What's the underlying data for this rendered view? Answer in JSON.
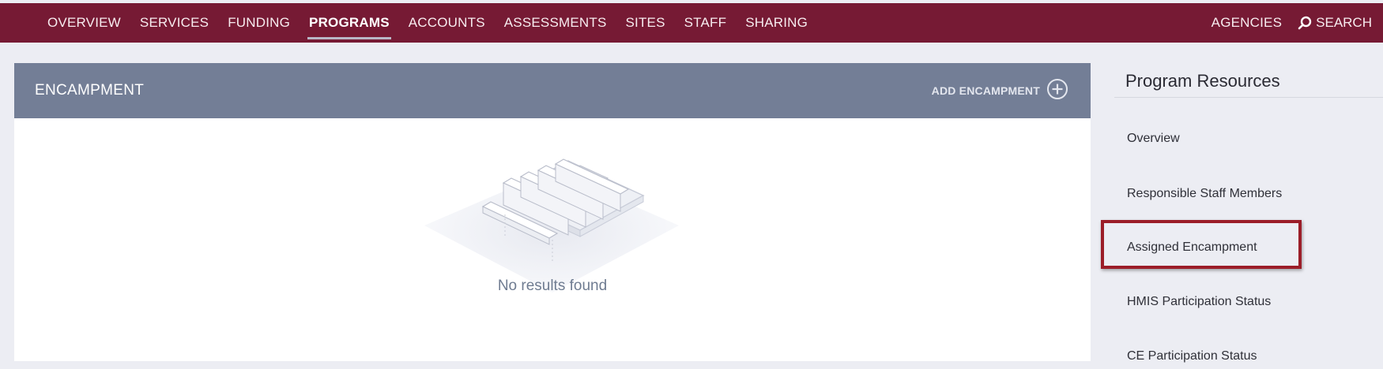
{
  "nav": {
    "left_items": [
      {
        "label": "OVERVIEW"
      },
      {
        "label": "SERVICES"
      },
      {
        "label": "FUNDING"
      },
      {
        "label": "PROGRAMS",
        "active": true
      },
      {
        "label": "ACCOUNTS"
      },
      {
        "label": "ASSESSMENTS"
      },
      {
        "label": "SITES"
      },
      {
        "label": "STAFF"
      },
      {
        "label": "SHARING"
      }
    ],
    "agencies_label": "AGENCIES",
    "search_label": "SEARCH",
    "search_icon": "search-icon"
  },
  "panel": {
    "title": "ENCAMPMENT",
    "add_label": "ADD ENCAMPMENT",
    "add_icon": "plus-circle-icon",
    "empty_text": "No results found"
  },
  "sidebar": {
    "title": "Program Resources",
    "items": [
      {
        "label": "Overview"
      },
      {
        "label": "Responsible Staff Members"
      },
      {
        "label": "Assigned Encampment",
        "highlighted": true
      },
      {
        "label": "HMIS Participation Status"
      },
      {
        "label": "CE Participation Status"
      }
    ]
  },
  "colors": {
    "topbar": "#761a34",
    "panel_header": "#737e96",
    "highlight_border": "#9b1d28",
    "page_background": "#ecedf3"
  }
}
